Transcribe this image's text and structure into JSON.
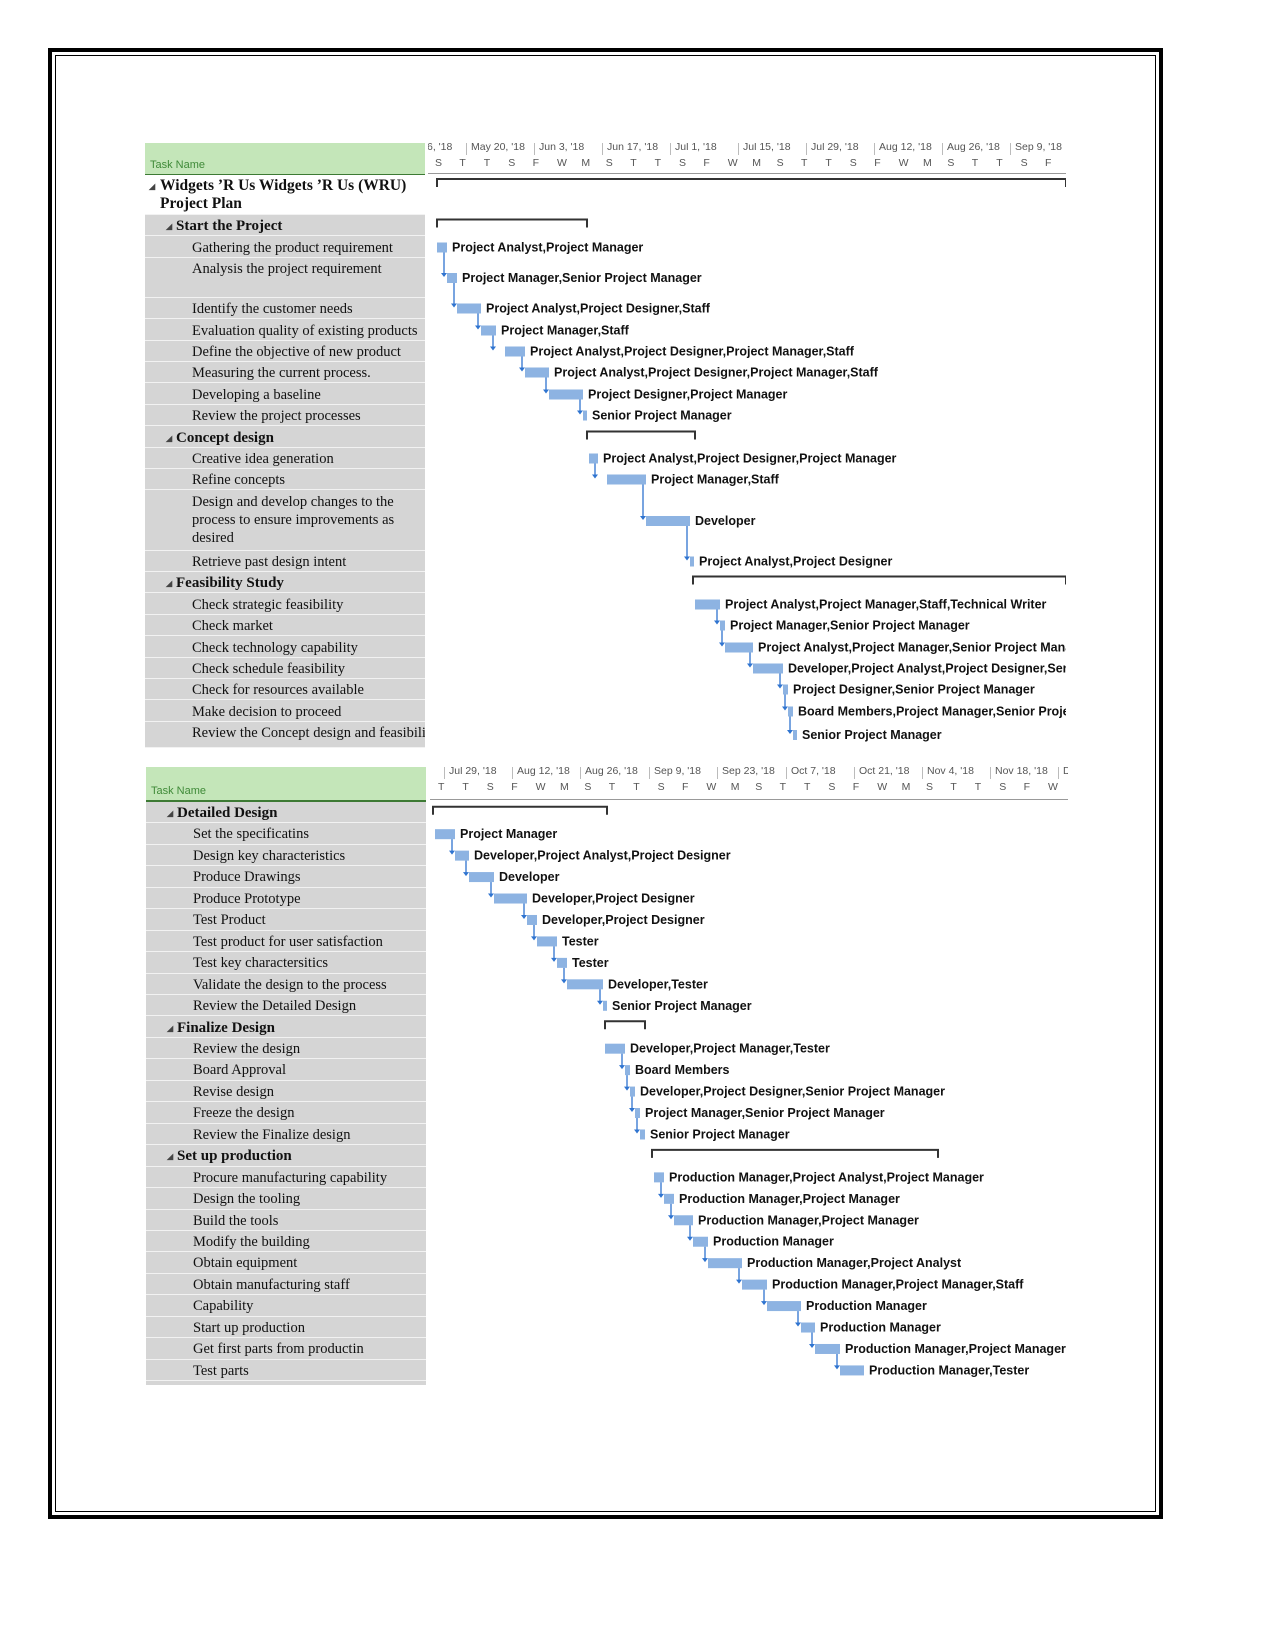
{
  "colors": {
    "bar": "#8db3e2",
    "link": "#2f74d0",
    "header_green": "#c4e6b9",
    "table_gray": "#d5d5d5"
  },
  "chart1": {
    "column_header": "Task Name",
    "major_scale": [
      "6, '18",
      "May 20, '18",
      "Jun 3, '18",
      "Jun 17, '18",
      "Jul 1, '18",
      "Jul 15, '18",
      "Jul 29, '18",
      "Aug 12, '18",
      "Aug 26, '18",
      "Sep 9, '18"
    ],
    "minor_scale": [
      "S",
      "T",
      "T",
      "S",
      "F",
      "W",
      "M",
      "S",
      "T",
      "T",
      "S",
      "F",
      "W",
      "M",
      "S",
      "T",
      "T",
      "S",
      "F",
      "W",
      "M",
      "S",
      "T",
      "T",
      "S",
      "F"
    ],
    "tasks": [
      {
        "name": "Widgets ’R Us Widgets ’R Us (WRU) Project Plan",
        "level": 0,
        "resources": ""
      },
      {
        "name": "Start the Project",
        "level": 1,
        "resources": ""
      },
      {
        "name": "Gathering the product requirement",
        "level": 2,
        "resources": "Project Analyst,Project Manager"
      },
      {
        "name": "Analysis the project requirement",
        "level": 2,
        "resources": "Project Manager,Senior Project Manager"
      },
      {
        "name": "Identify the customer needs",
        "level": 2,
        "resources": "Project Analyst,Project Designer,Staff"
      },
      {
        "name": "Evaluation quality of existing products",
        "level": 2,
        "resources": "Project Manager,Staff"
      },
      {
        "name": "Define the objective of new product",
        "level": 2,
        "resources": "Project Analyst,Project Designer,Project Manager,Staff"
      },
      {
        "name": "Measuring the current process.",
        "level": 2,
        "resources": "Project Analyst,Project Designer,Project Manager,Staff"
      },
      {
        "name": "Developing a baseline",
        "level": 2,
        "resources": "Project Designer,Project Manager"
      },
      {
        "name": "Review the project processes",
        "level": 2,
        "resources": "Senior Project Manager"
      },
      {
        "name": "Concept design",
        "level": 1,
        "resources": ""
      },
      {
        "name": "Creative idea generation",
        "level": 2,
        "resources": "Project Analyst,Project Designer,Project Manager"
      },
      {
        "name": "Refine concepts",
        "level": 2,
        "resources": "Project Manager,Staff"
      },
      {
        "name": "Design and develop changes to the process to ensure improvements as desired",
        "level": 2,
        "resources": "Developer"
      },
      {
        "name": "Retrieve past design intent",
        "level": 2,
        "resources": "Project Analyst,Project Designer"
      },
      {
        "name": "Feasibility Study",
        "level": 1,
        "resources": ""
      },
      {
        "name": "Check strategic feasibility",
        "level": 2,
        "resources": "Project Analyst,Project Manager,Staff,Technical Writer"
      },
      {
        "name": "Check market",
        "level": 2,
        "resources": "Project Manager,Senior Project Manager"
      },
      {
        "name": "Check technology capability",
        "level": 2,
        "resources": "Project Analyst,Project Manager,Senior Project Manager"
      },
      {
        "name": "Check schedule feasibility",
        "level": 2,
        "resources": "Developer,Project Analyst,Project Designer,Senior Project Manager"
      },
      {
        "name": "Check for resources available",
        "level": 2,
        "resources": "Project Designer,Senior Project Manager"
      },
      {
        "name": "Make decision to proceed",
        "level": 2,
        "resources": "Board Members,Project Manager,Senior Project Manager"
      },
      {
        "name": "Review the Concept design and feasibility study",
        "level": 2,
        "resources": "Senior Project Manager"
      }
    ]
  },
  "chart2": {
    "column_header": "Task Name",
    "major_scale": [
      "Jul 29, '18",
      "Aug 12, '18",
      "Aug 26, '18",
      "Sep 9, '18",
      "Sep 23, '18",
      "Oct 7, '18",
      "Oct 21, '18",
      "Nov 4, '18",
      "Nov 18, '18",
      "D"
    ],
    "minor_scale": [
      "T",
      "T",
      "S",
      "F",
      "W",
      "M",
      "S",
      "T",
      "T",
      "S",
      "F",
      "W",
      "M",
      "S",
      "T",
      "T",
      "S",
      "F",
      "W",
      "M",
      "S",
      "T",
      "T",
      "S",
      "F",
      "W"
    ],
    "tasks": [
      {
        "name": "Detailed Design",
        "level": 1,
        "resources": ""
      },
      {
        "name": "Set the specificatins",
        "level": 2,
        "resources": "Project Manager"
      },
      {
        "name": "Design key characteristics",
        "level": 2,
        "resources": "Developer,Project Analyst,Project Designer"
      },
      {
        "name": "Produce Drawings",
        "level": 2,
        "resources": "Developer"
      },
      {
        "name": "Produce Prototype",
        "level": 2,
        "resources": "Developer,Project Designer"
      },
      {
        "name": "Test Product",
        "level": 2,
        "resources": "Developer,Project Designer"
      },
      {
        "name": "Test product for user satisfaction",
        "level": 2,
        "resources": "Tester"
      },
      {
        "name": "Test key charactersitics",
        "level": 2,
        "resources": "Tester"
      },
      {
        "name": "Validate the design to the process",
        "level": 2,
        "resources": "Developer,Tester"
      },
      {
        "name": "Review the Detailed Design",
        "level": 2,
        "resources": "Senior Project Manager"
      },
      {
        "name": "Finalize Design",
        "level": 1,
        "resources": ""
      },
      {
        "name": "Review the design",
        "level": 2,
        "resources": "Developer,Project Manager,Tester"
      },
      {
        "name": "Board Approval",
        "level": 2,
        "resources": "Board Members"
      },
      {
        "name": "Revise design",
        "level": 2,
        "resources": "Developer,Project Designer,Senior Project Manager"
      },
      {
        "name": "Freeze the design",
        "level": 2,
        "resources": "Project Manager,Senior Project Manager"
      },
      {
        "name": "Review the Finalize design",
        "level": 2,
        "resources": "Senior Project Manager"
      },
      {
        "name": "Set up production",
        "level": 1,
        "resources": ""
      },
      {
        "name": "Procure manufacturing capability",
        "level": 2,
        "resources": "Production Manager,Project Analyst,Project Manager"
      },
      {
        "name": "Design the tooling",
        "level": 2,
        "resources": "Production Manager,Project Manager"
      },
      {
        "name": "Build the tools",
        "level": 2,
        "resources": "Production Manager,Project Manager"
      },
      {
        "name": "Modify the building",
        "level": 2,
        "resources": "Production Manager"
      },
      {
        "name": "Obtain equipment",
        "level": 2,
        "resources": "Production Manager,Project Analyst"
      },
      {
        "name": "Obtain manufacturing staff",
        "level": 2,
        "resources": "Production Manager,Project Manager,Staff"
      },
      {
        "name": "Capability",
        "level": 2,
        "resources": "Production Manager"
      },
      {
        "name": "Start up production",
        "level": 2,
        "resources": "Production Manager"
      },
      {
        "name": "Get first parts from productin",
        "level": 2,
        "resources": "Production Manager,Project Manager"
      },
      {
        "name": "Test parts",
        "level": 2,
        "resources": "Production Manager,Tester"
      }
    ]
  }
}
